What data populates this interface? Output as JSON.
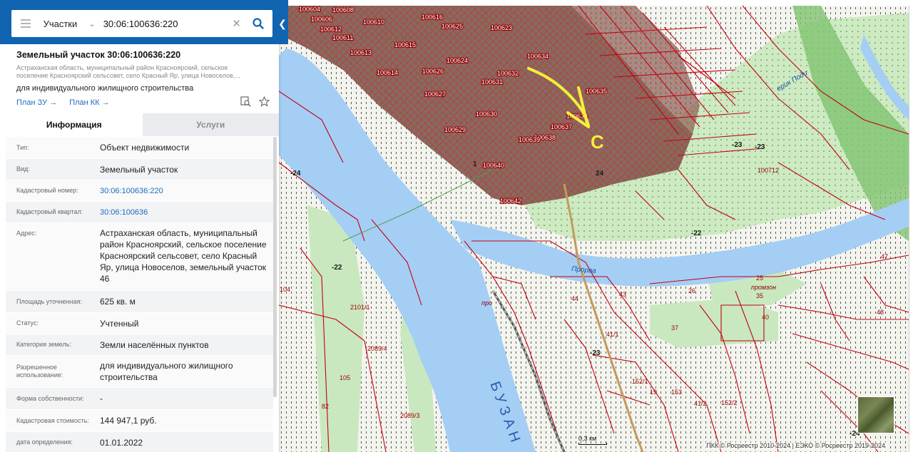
{
  "search": {
    "type_label": "Участки",
    "query": "30:06:100636:220"
  },
  "plot": {
    "title": "Земельный участок 30:06:100636:220",
    "address_short": "Астраханская область, муниципальный район Красноярский, сельское поселение Красноярский сельсовет, село Красный Яр, улица Новоселов,...",
    "permitted_use": "для индивидуального жилищного строительства",
    "links": [
      "План ЗУ",
      "План КК"
    ]
  },
  "tabs": [
    {
      "label": "Информация",
      "active": true
    },
    {
      "label": "Услуги",
      "active": false
    }
  ],
  "info_rows": [
    {
      "key": "Тип:",
      "value": "Объект недвижимости",
      "link": false
    },
    {
      "key": "Вид:",
      "value": "Земельный участок",
      "link": false
    },
    {
      "key": "Кадастровый номер:",
      "value": "30:06:100636:220",
      "link": true
    },
    {
      "key": "Кадастровый квартал:",
      "value": "30:06:100636",
      "link": true
    },
    {
      "key": "Адрес:",
      "value": "Астраханская область, муниципальный район Красноярский, сельское поселение Красноярский сельсовет, село Красный Яр, улица Новоселов, земельный участок 46",
      "link": false
    },
    {
      "key": "Площадь уточненная:",
      "value": "625 кв. м",
      "link": false
    },
    {
      "key": "Статус:",
      "value": "Учтенный",
      "link": false
    },
    {
      "key": "Категория земель:",
      "value": "Земли населённых пунктов",
      "link": false
    },
    {
      "key": "Разрешенное использование:",
      "value": "для индивидуального жилищного строительства",
      "link": false
    },
    {
      "key": "Форма собственности:",
      "value": "-",
      "link": false
    },
    {
      "key": "Кадастровая стоимость:",
      "value": "144 947,1 руб.",
      "link": false
    },
    {
      "key": "дата определения:",
      "value": "01.01.2022",
      "link": false
    }
  ],
  "map": {
    "quarter_labels": [
      "100604",
      "100608",
      "100606",
      "100612",
      "100610",
      "100611",
      "100616",
      "100625",
      "100623",
      "100615",
      "100613",
      "100614",
      "100626",
      "100624",
      "100634",
      "100632",
      "100631",
      "100627",
      "100635",
      "100630",
      "100633",
      "100637",
      "100629",
      "100638",
      "100639",
      "100640",
      "100642",
      "100712"
    ],
    "river_label": "БУЗАН",
    "stream_labels": [
      "ерик Поди",
      "Прорва"
    ],
    "parcel_numbers": [
      "-23",
      "-22",
      "-24",
      "104",
      "2101/1",
      "2089/4",
      "105",
      "82",
      "2089/3",
      "37",
      "41/1",
      "152/1",
      "153",
      "41/2",
      "152/2",
      "19",
      "47",
      "48",
      "40",
      "35",
      "25",
      "26",
      "43",
      "44",
      "24",
      "1",
      "-23",
      "-22",
      "-23",
      "-24"
    ],
    "place_labels": [
      "промзон",
      "про"
    ],
    "scale_text": "0,3 км",
    "attribution": "ПКК © Росреестр 2010-2024 | ЕЭКО © Росреестр 2019-2024",
    "colors": {
      "parcel": "#c4000f",
      "water": "#a5cef5",
      "green": "#c9e8bf",
      "urban": "#8a6e62"
    }
  },
  "annotation": {
    "mark": "C",
    "color": "#f5ef3a"
  }
}
